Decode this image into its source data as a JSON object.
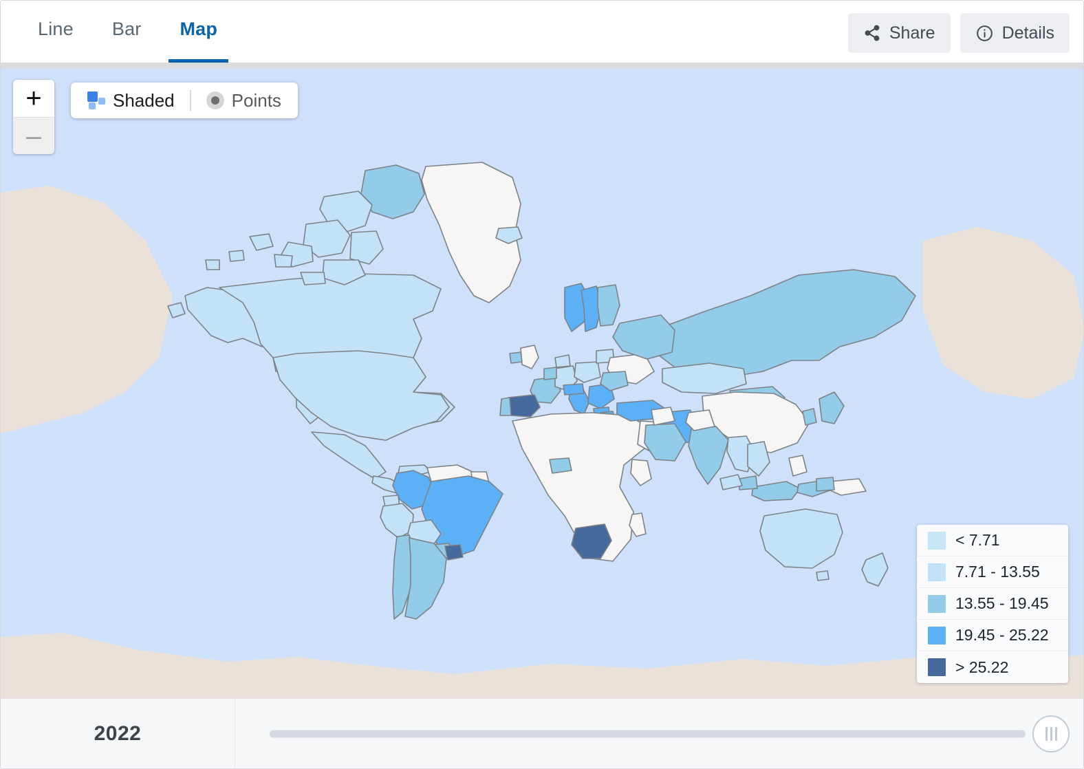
{
  "header": {
    "tabs": [
      {
        "label": "Line",
        "active": false
      },
      {
        "label": "Bar",
        "active": false
      },
      {
        "label": "Map",
        "active": true
      }
    ],
    "actions": [
      {
        "label": "Share",
        "icon": "share-icon"
      },
      {
        "label": "Details",
        "icon": "info-circle-icon"
      }
    ],
    "accent_color": "#0b63ab"
  },
  "map_controls": {
    "zoom_in": "+",
    "zoom_out": "–",
    "mode_shaded": "Shaded",
    "mode_points": "Points",
    "active_mode": "Shaded"
  },
  "legend": {
    "bins": [
      {
        "label": "< 7.71",
        "color": "#c6e6f8"
      },
      {
        "label": "7.71 - 13.55",
        "color": "#c3e2f7"
      },
      {
        "label": "13.55 - 19.45",
        "color": "#93cce8"
      },
      {
        "label": "19.45 - 25.22",
        "color": "#5cb0f5"
      },
      {
        "label": "> 25.22",
        "color": "#466a9c"
      }
    ]
  },
  "timeline": {
    "year": "2022",
    "slider_value": 100
  },
  "map_colors": {
    "ocean": "#cfe0fb",
    "no_data_land": "#f7f6f4",
    "antarctica": "#eae2d9",
    "border": "#7a7f85"
  },
  "chart_data": {
    "type": "heatmap",
    "title": "",
    "legend_position": "bottom-right",
    "bins": [
      "< 7.71",
      "7.71 - 13.55",
      "13.55 - 19.45",
      "19.45 - 25.22",
      "> 25.22"
    ],
    "bin_colors": [
      "#c6e6f8",
      "#c3e2f7",
      "#93cce8",
      "#5cb0f5",
      "#466a9c"
    ],
    "year": "2022",
    "regions": [
      {
        "name": "Canada",
        "bin": "7.71 - 13.55"
      },
      {
        "name": "United States",
        "bin": "7.71 - 13.55"
      },
      {
        "name": "Greenland",
        "bin": "no data"
      },
      {
        "name": "Mexico",
        "bin": "7.71 - 13.55"
      },
      {
        "name": "Brazil",
        "bin": "19.45 - 25.22"
      },
      {
        "name": "Colombia",
        "bin": "19.45 - 25.22"
      },
      {
        "name": "Peru",
        "bin": "7.71 - 13.55"
      },
      {
        "name": "Bolivia",
        "bin": "7.71 - 13.55"
      },
      {
        "name": "Argentina",
        "bin": "13.55 - 19.45"
      },
      {
        "name": "Chile",
        "bin": "13.55 - 19.45"
      },
      {
        "name": "Uruguay",
        "bin": "> 25.22"
      },
      {
        "name": "Paraguay",
        "bin": "13.55 - 19.45"
      },
      {
        "name": "Venezuela",
        "bin": "no data"
      },
      {
        "name": "Spain",
        "bin": "> 25.22"
      },
      {
        "name": "Portugal",
        "bin": "13.55 - 19.45"
      },
      {
        "name": "France",
        "bin": "13.55 - 19.45"
      },
      {
        "name": "Germany",
        "bin": "7.71 - 13.55"
      },
      {
        "name": "Italy",
        "bin": "19.45 - 25.22"
      },
      {
        "name": "Poland",
        "bin": "7.71 - 13.55"
      },
      {
        "name": "Norway",
        "bin": "19.45 - 25.22"
      },
      {
        "name": "Sweden",
        "bin": "19.45 - 25.22"
      },
      {
        "name": "Finland",
        "bin": "13.55 - 19.45"
      },
      {
        "name": "United Kingdom",
        "bin": "no data"
      },
      {
        "name": "Ireland",
        "bin": "13.55 - 19.45"
      },
      {
        "name": "Ukraine",
        "bin": "no data"
      },
      {
        "name": "Russia",
        "bin": "13.55 - 19.45"
      },
      {
        "name": "Kazakhstan",
        "bin": "7.71 - 13.55"
      },
      {
        "name": "Mongolia",
        "bin": "13.55 - 19.45"
      },
      {
        "name": "China",
        "bin": "no data"
      },
      {
        "name": "India",
        "bin": "13.55 - 19.45"
      },
      {
        "name": "Turkey",
        "bin": "19.45 - 25.22"
      },
      {
        "name": "Iran",
        "bin": "19.45 - 25.22"
      },
      {
        "name": "Saudi Arabia",
        "bin": "13.55 - 19.45"
      },
      {
        "name": "Egypt",
        "bin": "no data"
      },
      {
        "name": "Algeria",
        "bin": "no data"
      },
      {
        "name": "Nigeria",
        "bin": "no data"
      },
      {
        "name": "Botswana",
        "bin": "> 25.22"
      },
      {
        "name": "South Africa",
        "bin": "> 25.22"
      },
      {
        "name": "Australia",
        "bin": "7.71 - 13.55"
      },
      {
        "name": "New Zealand",
        "bin": "7.71 - 13.55"
      },
      {
        "name": "Indonesia",
        "bin": "13.55 - 19.45"
      },
      {
        "name": "Japan",
        "bin": "13.55 - 19.45"
      },
      {
        "name": "Vietnam",
        "bin": "7.71 - 13.55"
      },
      {
        "name": "Thailand",
        "bin": "7.71 - 13.55"
      },
      {
        "name": "Philippines",
        "bin": "no data"
      }
    ]
  }
}
